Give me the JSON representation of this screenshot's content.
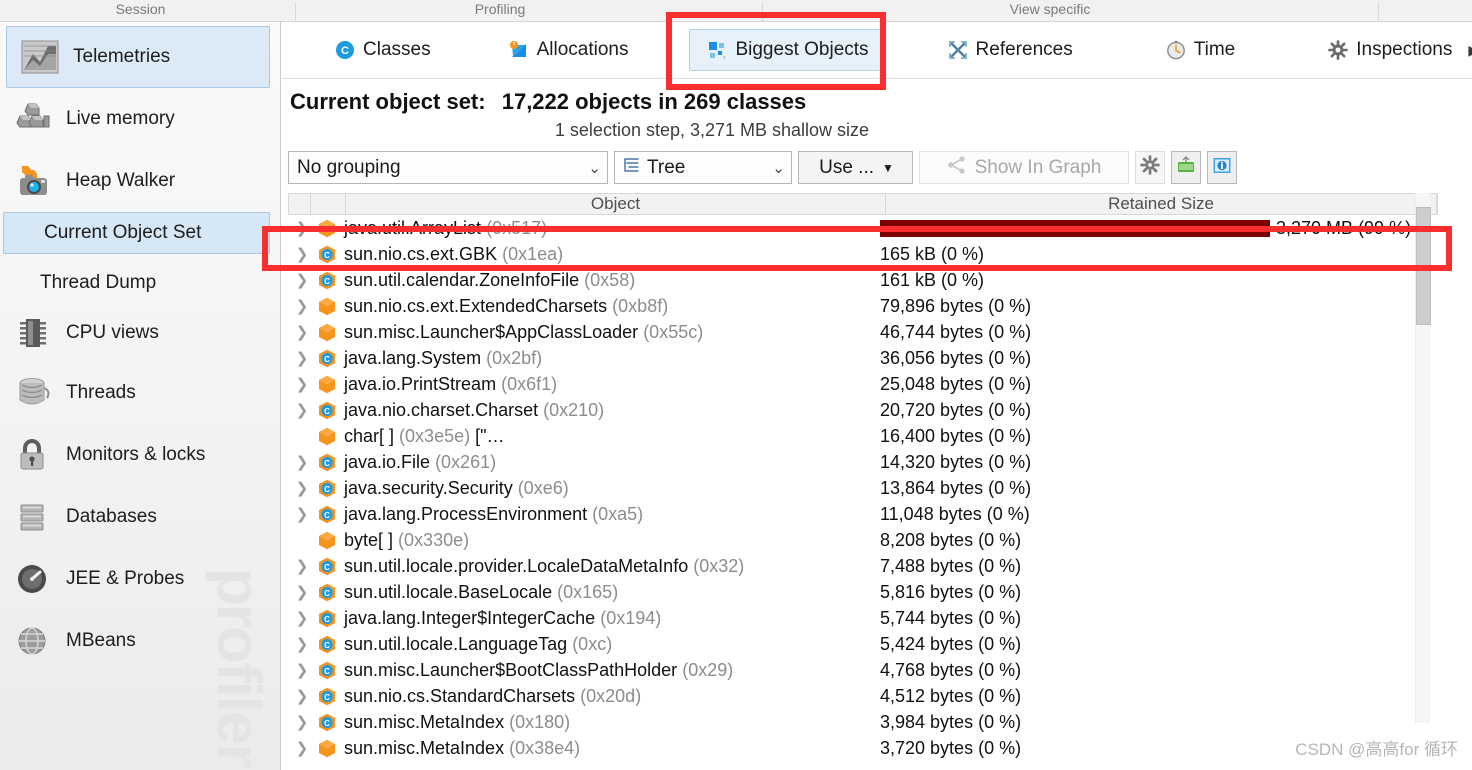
{
  "topstrip": {
    "categories": [
      "Session",
      "Profiling",
      "View specific"
    ]
  },
  "sidebar": {
    "items": [
      {
        "label": "Telemetries",
        "icon": "telemetries-icon",
        "selected": true
      },
      {
        "label": "Live memory",
        "icon": "live-memory-icon",
        "selected": false
      },
      {
        "label": "Heap Walker",
        "icon": "heap-walker-icon",
        "selected": false
      },
      {
        "label": "CPU views",
        "icon": "cpu-views-icon",
        "selected": false
      },
      {
        "label": "Threads",
        "icon": "threads-icon",
        "selected": false
      },
      {
        "label": "Monitors & locks",
        "icon": "monitors-locks-icon",
        "selected": false
      },
      {
        "label": "Databases",
        "icon": "databases-icon",
        "selected": false
      },
      {
        "label": "JEE & Probes",
        "icon": "jee-probes-icon",
        "selected": false
      },
      {
        "label": "MBeans",
        "icon": "mbeans-icon",
        "selected": false
      }
    ],
    "sub": [
      {
        "label": "Current Object Set",
        "selected": true
      },
      {
        "label": "Thread Dump",
        "selected": false
      }
    ],
    "watermark": "profiler"
  },
  "tabs": [
    {
      "label": "Classes",
      "icon": "classes-icon",
      "active": false
    },
    {
      "label": "Allocations",
      "icon": "allocations-icon",
      "active": false
    },
    {
      "label": "Biggest Objects",
      "icon": "biggest-objects-icon",
      "active": true
    },
    {
      "label": "References",
      "icon": "references-icon",
      "active": false
    },
    {
      "label": "Time",
      "icon": "time-icon",
      "active": false
    },
    {
      "label": "Inspections",
      "icon": "inspections-icon",
      "active": false
    }
  ],
  "tab_overflow": "▶",
  "heading": {
    "prefix": "Current object set:",
    "value": "17,222 objects in 269 classes",
    "sub": "1 selection step, 3,271 MB shallow size"
  },
  "toolbar": {
    "grouping": "No grouping",
    "view_mode": "Tree",
    "use_button": "Use ...",
    "show_in_graph": "Show In Graph",
    "settings_icon": "gear-icon",
    "export_icon": "export-icon",
    "info_icon": "info-icon"
  },
  "table": {
    "columns": [
      "Object",
      "Retained Size"
    ],
    "rows": [
      {
        "name": "java.util.ArrayList",
        "addr": "(0x517)",
        "suffix": "",
        "icon": "instance-icon",
        "expandable": true,
        "size": "3,270 MB (99 %)",
        "bar_pct": 100
      },
      {
        "name": "sun.nio.cs.ext.GBK",
        "addr": "(0x1ea)",
        "suffix": "",
        "icon": "class-icon",
        "expandable": true,
        "size": "165 kB (0 %)",
        "bar_pct": 0
      },
      {
        "name": "sun.util.calendar.ZoneInfoFile",
        "addr": "(0x58)",
        "suffix": "",
        "icon": "class-icon",
        "expandable": true,
        "size": "161 kB (0 %)",
        "bar_pct": 0
      },
      {
        "name": "sun.nio.cs.ext.ExtendedCharsets",
        "addr": "(0xb8f)",
        "suffix": "",
        "icon": "instance-icon",
        "expandable": true,
        "size": "79,896 bytes (0 %)",
        "bar_pct": 0
      },
      {
        "name": "sun.misc.Launcher$AppClassLoader",
        "addr": "(0x55c)",
        "suffix": "",
        "icon": "instance-icon",
        "expandable": true,
        "size": "46,744 bytes (0 %)",
        "bar_pct": 0
      },
      {
        "name": "java.lang.System",
        "addr": "(0x2bf)",
        "suffix": "",
        "icon": "class-icon",
        "expandable": true,
        "size": "36,056 bytes (0 %)",
        "bar_pct": 0
      },
      {
        "name": "java.io.PrintStream",
        "addr": "(0x6f1)",
        "suffix": "",
        "icon": "instance-icon",
        "expandable": true,
        "size": "25,048 bytes (0 %)",
        "bar_pct": 0
      },
      {
        "name": "java.nio.charset.Charset",
        "addr": "(0x210)",
        "suffix": "",
        "icon": "class-icon",
        "expandable": true,
        "size": "20,720 bytes (0 %)",
        "bar_pct": 0
      },
      {
        "name": "char[ ]",
        "addr": "(0x3e5e)",
        "suffix": "[\"…",
        "icon": "instance-icon",
        "expandable": false,
        "size": "16,400 bytes (0 %)",
        "bar_pct": 0
      },
      {
        "name": "java.io.File",
        "addr": "(0x261)",
        "suffix": "",
        "icon": "class-icon",
        "expandable": true,
        "size": "14,320 bytes (0 %)",
        "bar_pct": 0
      },
      {
        "name": "java.security.Security",
        "addr": "(0xe6)",
        "suffix": "",
        "icon": "class-icon",
        "expandable": true,
        "size": "13,864 bytes (0 %)",
        "bar_pct": 0
      },
      {
        "name": "java.lang.ProcessEnvironment",
        "addr": "(0xa5)",
        "suffix": "",
        "icon": "class-icon",
        "expandable": true,
        "size": "11,048 bytes (0 %)",
        "bar_pct": 0
      },
      {
        "name": "byte[ ]",
        "addr": "(0x330e)",
        "suffix": "",
        "icon": "instance-icon",
        "expandable": false,
        "size": "8,208 bytes (0 %)",
        "bar_pct": 0
      },
      {
        "name": "sun.util.locale.provider.LocaleDataMetaInfo",
        "addr": "(0x32)",
        "suffix": "",
        "icon": "class-icon",
        "expandable": true,
        "size": "7,488 bytes (0 %)",
        "bar_pct": 0
      },
      {
        "name": "sun.util.locale.BaseLocale",
        "addr": "(0x165)",
        "suffix": "",
        "icon": "class-icon",
        "expandable": true,
        "size": "5,816 bytes (0 %)",
        "bar_pct": 0
      },
      {
        "name": "java.lang.Integer$IntegerCache",
        "addr": "(0x194)",
        "suffix": "",
        "icon": "class-icon",
        "expandable": true,
        "size": "5,744 bytes (0 %)",
        "bar_pct": 0
      },
      {
        "name": "sun.util.locale.LanguageTag",
        "addr": "(0xc)",
        "suffix": "",
        "icon": "class-icon",
        "expandable": true,
        "size": "5,424 bytes (0 %)",
        "bar_pct": 0
      },
      {
        "name": "sun.misc.Launcher$BootClassPathHolder",
        "addr": "(0x29)",
        "suffix": "",
        "icon": "class-icon",
        "expandable": true,
        "size": "4,768 bytes (0 %)",
        "bar_pct": 0
      },
      {
        "name": "sun.nio.cs.StandardCharsets",
        "addr": "(0x20d)",
        "suffix": "",
        "icon": "class-icon",
        "expandable": true,
        "size": "4,512 bytes (0 %)",
        "bar_pct": 0
      },
      {
        "name": "sun.misc.MetaIndex",
        "addr": "(0x180)",
        "suffix": "",
        "icon": "class-icon",
        "expandable": true,
        "size": "3,984 bytes (0 %)",
        "bar_pct": 0
      },
      {
        "name": "sun.misc.MetaIndex",
        "addr": "(0x38e4)",
        "suffix": "",
        "icon": "instance-icon",
        "expandable": true,
        "size": "3,720 bytes (0 %)",
        "bar_pct": 0
      }
    ]
  },
  "watermark": "CSDN @高高for 循环",
  "colors": {
    "accent": "#1e8fe0",
    "selection": "#dceaf7",
    "bar": "#7c0000",
    "annotation": "#f92f2f",
    "instance_icon": "#f7941e",
    "class_icon": "#1e9bdd"
  }
}
